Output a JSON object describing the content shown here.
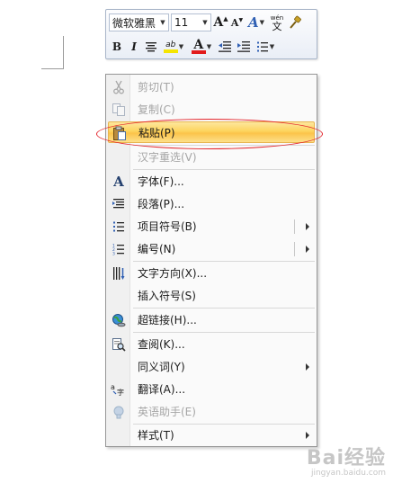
{
  "mini_toolbar": {
    "font_name": "微软雅黑",
    "font_size": "11",
    "bold": "B",
    "italic": "I",
    "font_color_glyph": "A",
    "grow_font": "A",
    "shrink_font": "A",
    "styles_glyph": "A",
    "highlight_text": "ab",
    "phonetic_top": "wén",
    "phonetic_char": "文"
  },
  "context_menu": {
    "items": [
      {
        "id": "cut",
        "label": "剪切(T)",
        "icon": "scissors-icon",
        "disabled": true
      },
      {
        "id": "copy",
        "label": "复制(C)",
        "icon": "copy-icon",
        "disabled": true
      },
      {
        "id": "paste",
        "label": "粘贴(P)",
        "icon": "clipboard-paste-icon",
        "disabled": false,
        "highlighted": true
      },
      {
        "id": "reconvert",
        "label": "汉字重选(V)",
        "icon": "",
        "disabled": true
      },
      {
        "id": "font",
        "label": "字体(F)...",
        "icon": "font-icon",
        "disabled": false
      },
      {
        "id": "paragraph",
        "label": "段落(P)...",
        "icon": "paragraph-icon",
        "disabled": false
      },
      {
        "id": "bullets",
        "label": "项目符号(B)",
        "icon": "bullets-icon",
        "disabled": false,
        "submenu": true
      },
      {
        "id": "numbering",
        "label": "编号(N)",
        "icon": "numbering-icon",
        "disabled": false,
        "submenu": true
      },
      {
        "id": "text_direction",
        "label": "文字方向(X)...",
        "icon": "text-direction-icon",
        "disabled": false
      },
      {
        "id": "insert_symbol",
        "label": "插入符号(S)",
        "icon": "",
        "disabled": false
      },
      {
        "id": "hyperlink",
        "label": "超链接(H)...",
        "icon": "globe-link-icon",
        "disabled": false
      },
      {
        "id": "lookup",
        "label": "查阅(K)...",
        "icon": "lookup-icon",
        "disabled": false
      },
      {
        "id": "synonyms",
        "label": "同义词(Y)",
        "icon": "",
        "disabled": false,
        "submenu": true
      },
      {
        "id": "translate",
        "label": "翻译(A)...",
        "icon": "translate-icon",
        "disabled": false
      },
      {
        "id": "english_assistant",
        "label": "英语助手(E)",
        "icon": "assistant-icon",
        "disabled": true
      },
      {
        "id": "styles",
        "label": "样式(T)",
        "icon": "",
        "disabled": false,
        "submenu": true
      }
    ]
  },
  "watermark": {
    "main": "Bai经验",
    "sub": "jingyan.baidu.com"
  },
  "colors": {
    "highlight": "#fcc44a",
    "annotation": "#e4252c",
    "font_color": "#e21c1c",
    "highlight_color": "#f5e500"
  }
}
